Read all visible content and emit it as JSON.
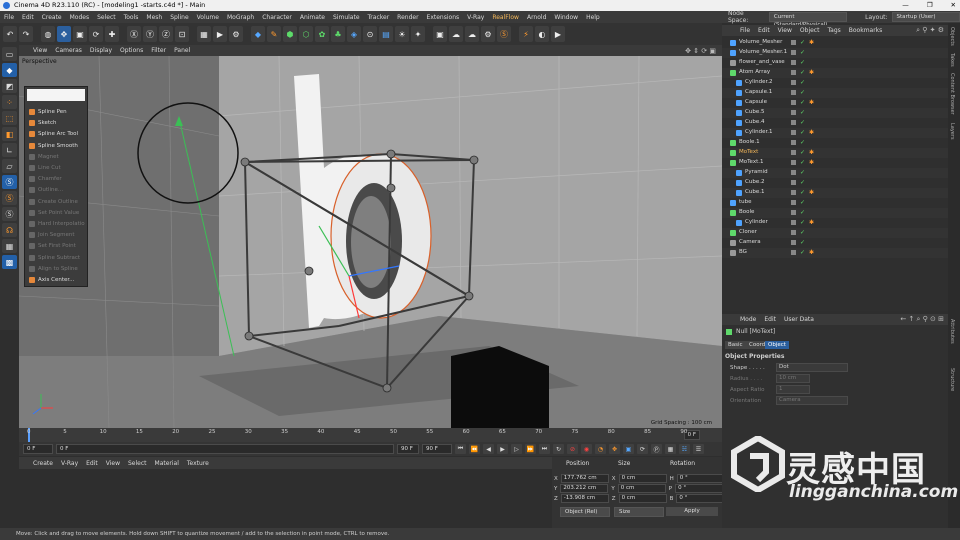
{
  "window": {
    "title": "Cinema 4D R23.110 (RC) - [modeling1 -starts.c4d *] - Main",
    "controls": [
      "—",
      "❐",
      "✕"
    ]
  },
  "menubar": {
    "items": [
      "File",
      "Edit",
      "Create",
      "Modes",
      "Select",
      "Tools",
      "Mesh",
      "Spline",
      "Volume",
      "MoGraph",
      "Character",
      "Animate",
      "Simulate",
      "Tracker",
      "Render",
      "Extensions",
      "V-Ray",
      "RealFlow",
      "Arnold",
      "Window",
      "Help"
    ],
    "highlighted": "RealFlow",
    "node_space_label": "Node Space:",
    "node_space_value": "Current (Standard/Physical)",
    "layout_label": "Layout:",
    "layout_value": "Startup (User)"
  },
  "viewport": {
    "menu": [
      "View",
      "Cameras",
      "Display",
      "Options",
      "Filter",
      "Panel"
    ],
    "label": "Perspective",
    "grid_spacing": "Grid Spacing : 100 cm"
  },
  "popup_menu": {
    "items": [
      {
        "label": "Spline Pen",
        "enabled": true
      },
      {
        "label": "Sketch",
        "enabled": true
      },
      {
        "label": "Spline Arc Tool",
        "enabled": true
      },
      {
        "label": "Spline Smooth",
        "enabled": true
      },
      {
        "label": "Magnet",
        "enabled": false
      },
      {
        "label": "Line Cut",
        "enabled": false
      },
      {
        "label": "Chamfer",
        "enabled": false
      },
      {
        "label": "Outline...",
        "enabled": false
      },
      {
        "label": "Create Outline",
        "enabled": false
      },
      {
        "label": "Set Point Value",
        "enabled": false
      },
      {
        "label": "Hard Interpolation",
        "enabled": false
      },
      {
        "label": "Join Segment",
        "enabled": false
      },
      {
        "label": "Set First Point",
        "enabled": false
      },
      {
        "label": "Spline Subtract",
        "enabled": false
      },
      {
        "label": "Align to Spline",
        "enabled": false
      },
      {
        "label": "Axis Center...",
        "enabled": true
      }
    ]
  },
  "timeline": {
    "ticks": [
      "0",
      "5",
      "10",
      "15",
      "20",
      "25",
      "30",
      "35",
      "40",
      "45",
      "50",
      "55",
      "60",
      "65",
      "70",
      "75",
      "80",
      "85",
      "90"
    ],
    "end_frame": "0 F",
    "current": "0 F",
    "start": "0 F",
    "end": "90 F",
    "end2": "90 F"
  },
  "material_menu": [
    "Create",
    "V-Ray",
    "Edit",
    "View",
    "Select",
    "Material",
    "Texture"
  ],
  "coordinates": {
    "headers": [
      "Position",
      "Size",
      "Rotation"
    ],
    "rows": [
      {
        "axis": "X",
        "pos": "177.762 cm",
        "size_axis": "X",
        "size": "0 cm",
        "rot_axis": "H",
        "rot": "0 °"
      },
      {
        "axis": "Y",
        "pos": "203.212 cm",
        "size_axis": "Y",
        "size": "0 cm",
        "rot_axis": "P",
        "rot": "0 °"
      },
      {
        "axis": "Z",
        "pos": "-13.908 cm",
        "size_axis": "Z",
        "size": "0 cm",
        "rot_axis": "B",
        "rot": "0 °"
      }
    ],
    "mode": "Object (Rel)",
    "size_mode": "Size",
    "apply": "Apply"
  },
  "object_manager": {
    "menu": [
      "File",
      "Edit",
      "View",
      "Object",
      "Tags",
      "Bookmarks"
    ],
    "objects": [
      {
        "name": "Volume_Mesher",
        "indent": 1,
        "icon": "#4fa3ff",
        "orange": false
      },
      {
        "name": "Volume_Mesher.1",
        "indent": 1,
        "icon": "#4fa3ff",
        "orange": false
      },
      {
        "name": "flower_and_vase",
        "indent": 1,
        "icon": "#9a9a9a",
        "orange": false
      },
      {
        "name": "Atom Array",
        "indent": 1,
        "icon": "#5fd96b",
        "orange": false
      },
      {
        "name": "Cylinder.2",
        "indent": 2,
        "icon": "#4fa3ff",
        "orange": false
      },
      {
        "name": "Capsule.1",
        "indent": 2,
        "icon": "#4fa3ff",
        "orange": false
      },
      {
        "name": "Capsule",
        "indent": 2,
        "icon": "#4fa3ff",
        "orange": false
      },
      {
        "name": "Cube.5",
        "indent": 2,
        "icon": "#4fa3ff",
        "orange": false
      },
      {
        "name": "Cube.4",
        "indent": 2,
        "icon": "#4fa3ff",
        "orange": false
      },
      {
        "name": "Cylinder.1",
        "indent": 2,
        "icon": "#4fa3ff",
        "orange": false
      },
      {
        "name": "Boole.1",
        "indent": 1,
        "icon": "#5fd96b",
        "orange": false
      },
      {
        "name": "MoText",
        "indent": 1,
        "icon": "#5fd96b",
        "orange": true
      },
      {
        "name": "MoText.1",
        "indent": 1,
        "icon": "#5fd96b",
        "orange": false
      },
      {
        "name": "Pyramid",
        "indent": 2,
        "icon": "#4fa3ff",
        "orange": false
      },
      {
        "name": "Cube.2",
        "indent": 2,
        "icon": "#4fa3ff",
        "orange": false
      },
      {
        "name": "Cube.1",
        "indent": 2,
        "icon": "#4fa3ff",
        "orange": false
      },
      {
        "name": "tube",
        "indent": 1,
        "icon": "#4fa3ff",
        "orange": false
      },
      {
        "name": "Boole",
        "indent": 1,
        "icon": "#5fd96b",
        "orange": false
      },
      {
        "name": "Cylinder",
        "indent": 2,
        "icon": "#4fa3ff",
        "orange": false
      },
      {
        "name": "Cloner",
        "indent": 1,
        "icon": "#5fd96b",
        "orange": false
      },
      {
        "name": "Camera",
        "indent": 1,
        "icon": "#9a9a9a",
        "orange": false
      },
      {
        "name": "BG",
        "indent": 1,
        "icon": "#9a9a9a",
        "orange": false
      }
    ]
  },
  "attribute_manager": {
    "menu": [
      "Mode",
      "Edit",
      "User Data"
    ],
    "object_label": "Null [MoText]",
    "tabs": [
      "Basic",
      "Coord.",
      "Object"
    ],
    "active_tab": "Object",
    "section": "Object Properties",
    "shape_label": "Shape . . . . .",
    "shape_value": "Dot",
    "radius_label": "Radius . . . .",
    "radius_value": "10 cm",
    "aspect_label": "Aspect Ratio",
    "aspect_value": "1",
    "orientation_label": "Orientation",
    "orientation_value": "Camera"
  },
  "right_tabs": [
    "Objects",
    "Takes",
    "Content Browser",
    "Layers",
    "Attributes",
    "Structure"
  ],
  "status": "Move: Click and drag to move elements. Hold down SHIFT to quantize movement / add to the selection in point mode, CTRL to remove.",
  "watermark": {
    "cn": "灵感中国",
    "url": "lingganchina.com"
  },
  "colors": {
    "accent": "#2b5f9e",
    "selection_orange": "#f5b85a"
  }
}
